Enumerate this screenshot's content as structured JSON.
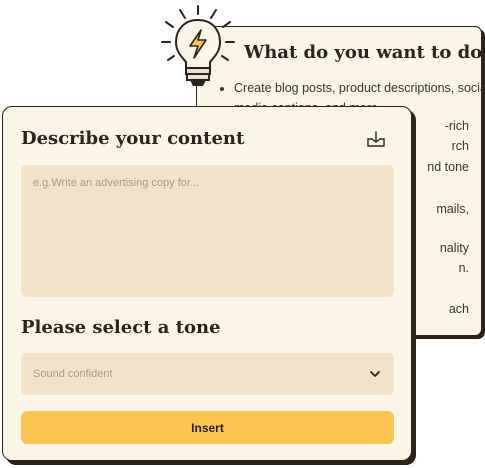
{
  "back_card": {
    "title": "What do you want to do?",
    "bullets": [
      "Create blog posts, product descriptions, social media captions, and more"
    ],
    "partial_lines": [
      "-rich",
      "rch",
      "nd tone",
      "mails,",
      "nality",
      "n.",
      "ach"
    ]
  },
  "front_card": {
    "content_title": "Describe your content",
    "content_placeholder": "e.g.Write an advertising copy for...",
    "tone_title": "Please select a tone",
    "tone_selected": "Sound confident",
    "insert_label": "Insert"
  },
  "icons": {
    "bulb": "lightbulb-icon",
    "lightning": "lightning-icon",
    "download": "download-icon",
    "chevron": "chevron-down-icon"
  },
  "colors": {
    "card_bg": "#fbf5e8",
    "field_bg": "#f3e3c6",
    "accent": "#fcc552",
    "ink": "#2a241d"
  }
}
